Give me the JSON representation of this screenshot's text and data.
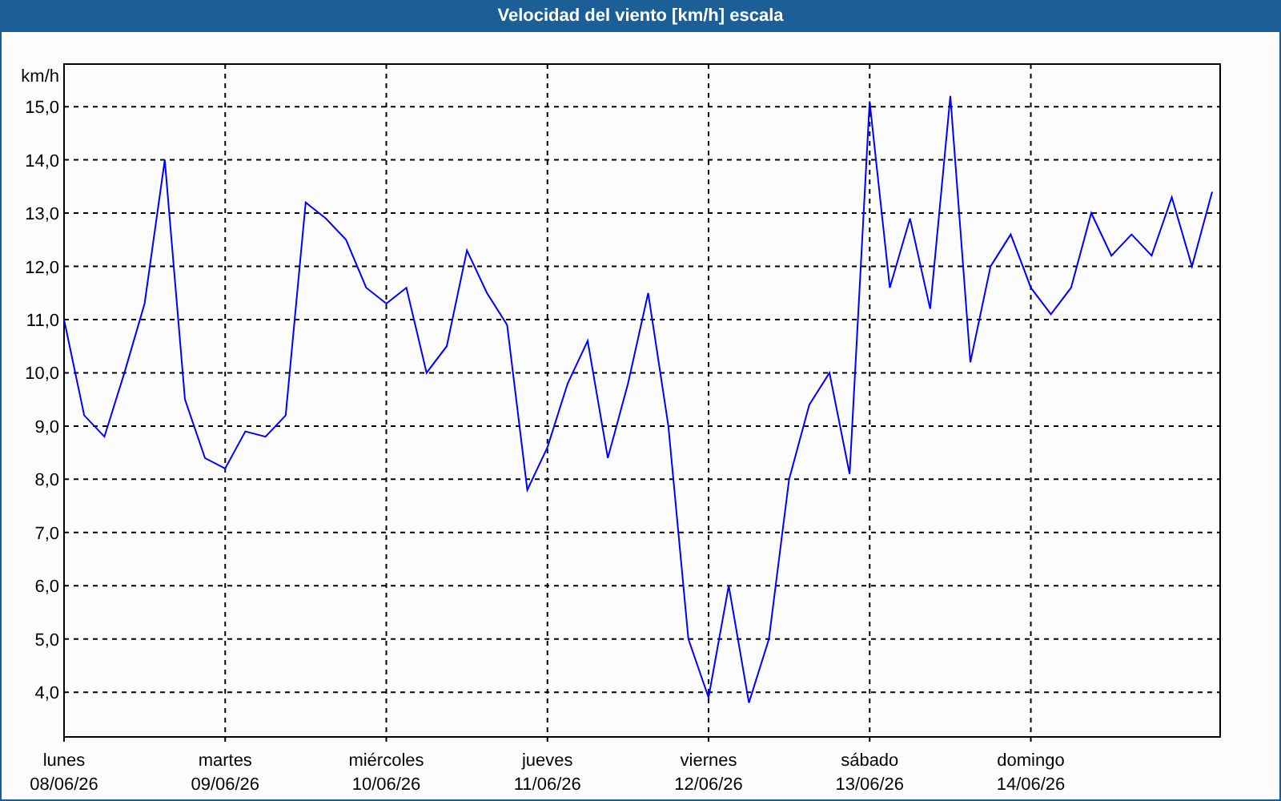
{
  "chart": {
    "chart_data": {
      "type": "line",
      "title": "Velocidad del viento [km/h] escala",
      "ylabel": "km/h",
      "grid": true,
      "ylim": [
        3.16,
        15.8
      ],
      "categories": [
        "lunes 08/06/26",
        null,
        null,
        null,
        null,
        null,
        null,
        null,
        "martes 09/06/26",
        null,
        null,
        null,
        null,
        null,
        null,
        null,
        "miércoles 10/06/26",
        null,
        null,
        null,
        null,
        null,
        null,
        null,
        "jueves 11/06/26",
        null,
        null,
        null,
        null,
        null,
        null,
        null,
        "viernes 12/06/26",
        null,
        null,
        null,
        null,
        null,
        null,
        null,
        "sábado 13/06/26",
        null,
        null,
        null,
        null,
        null,
        null,
        null,
        "domingo 14/06/26",
        null,
        null,
        null,
        null,
        null,
        null,
        null,
        null,
        null
      ],
      "series": [
        {
          "color": "#0000ff",
          "values": [
            11.0,
            9.2,
            8.8,
            10.0,
            11.3,
            14.0,
            9.5,
            8.4,
            8.2,
            8.9,
            8.8,
            9.2,
            13.2,
            12.9,
            12.5,
            11.6,
            11.3,
            11.6,
            10.0,
            10.5,
            12.3,
            11.5,
            10.9,
            7.8,
            8.6,
            9.8,
            10.6,
            8.4,
            9.8,
            11.5,
            9.0,
            5.0,
            3.9,
            6.0,
            3.8,
            5.0,
            8.0,
            9.4,
            10.0,
            8.1,
            15.1,
            11.6,
            12.9,
            11.2,
            15.2,
            10.2,
            12.0,
            12.6,
            11.6,
            11.1,
            11.6,
            13.0,
            12.2,
            12.6,
            12.2,
            13.3,
            12.0,
            13.4
          ]
        }
      ],
      "yticks": [
        {
          "value": 4,
          "label": "4,0"
        },
        {
          "value": 5,
          "label": "5,0"
        },
        {
          "value": 6,
          "label": "6,0"
        },
        {
          "value": 7,
          "label": "7,0"
        },
        {
          "value": 8,
          "label": "8,0"
        },
        {
          "value": 9,
          "label": "9,0"
        },
        {
          "value": 10,
          "label": "10,0"
        },
        {
          "value": 11,
          "label": "11,0"
        },
        {
          "value": 12,
          "label": "12,0"
        },
        {
          "value": 13,
          "label": "13,0"
        },
        {
          "value": 14,
          "label": "14,0"
        },
        {
          "value": 15,
          "label": "15,0"
        }
      ]
    }
  }
}
